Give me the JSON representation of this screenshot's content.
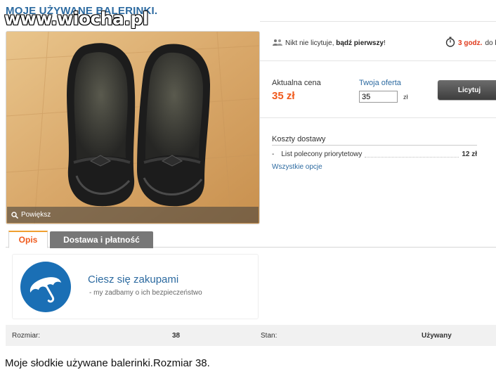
{
  "page": {
    "title": "MOJE UŻYWANE BALERINKI.",
    "watermark": "www.wiocha.pl"
  },
  "gallery": {
    "zoom_label": "Powiększ"
  },
  "auction": {
    "bid_status_prefix": "Nikt nie licytuje,",
    "bid_status_bold": "bądź pierwszy",
    "bid_status_suffix": "!",
    "time_left_value": "3 godz.",
    "time_left_suffix": "do k"
  },
  "pricing": {
    "current_price_label": "Aktualna cena",
    "current_price": "35 zł",
    "your_offer_label": "Twoja oferta",
    "your_offer_value": "35",
    "offer_currency": "zł",
    "bid_button_label": "Licytuj"
  },
  "shipping": {
    "title": "Koszty dostawy",
    "options": [
      {
        "bullet": "-",
        "name": "List polecony priorytetowy",
        "price": "12 zł"
      }
    ],
    "all_options_link": "Wszystkie opcje"
  },
  "tabs": [
    {
      "label": "Opis",
      "active": true
    },
    {
      "label": "Dostawa i płatność",
      "active": false
    }
  ],
  "promo": {
    "title": "Ciesz się zakupami",
    "subtitle": "-  my zadbamy o ich bezpieczeństwo"
  },
  "attributes": {
    "size_label": "Rozmiar:",
    "size_value": "38",
    "condition_label": "Stan:",
    "condition_value": "Używany"
  },
  "description": "Moje słodkie używane balerinki.Rozmiar 38.",
  "colors": {
    "accent_orange": "#f05a1c",
    "link_blue": "#2c6aa0",
    "umbrella_blue": "#1a6fb5"
  },
  "icons": {
    "bidders": "people-icon",
    "timer": "stopwatch-icon",
    "zoom": "magnifier-icon",
    "promo": "umbrella-icon"
  }
}
